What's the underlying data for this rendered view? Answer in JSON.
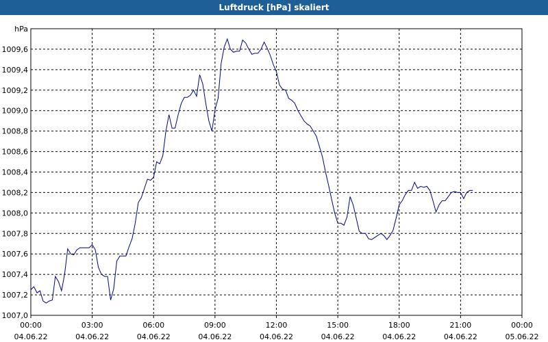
{
  "window": {
    "title": "Luftdruck [hPa] skaliert"
  },
  "chart_data": {
    "type": "line",
    "title": "Luftdruck [hPa] skaliert",
    "ylabel": "hPa",
    "xlabel": "",
    "ylim": [
      1007.0,
      1009.8
    ],
    "xlim": [
      0,
      24
    ],
    "grid": true,
    "y_ticks": [
      "1007,0",
      "1007,2",
      "1007,4",
      "1007,6",
      "1007,8",
      "1008,0",
      "1008,2",
      "1008,4",
      "1008,6",
      "1008,8",
      "1009,0",
      "1009,2",
      "1009,4",
      "1009,6"
    ],
    "x_ticks": [
      {
        "time": "00:00",
        "date": "04.06.22"
      },
      {
        "time": "03:00",
        "date": "04.06.22"
      },
      {
        "time": "06:00",
        "date": "04.06.22"
      },
      {
        "time": "09:00",
        "date": "04.06.22"
      },
      {
        "time": "12:00",
        "date": "04.06.22"
      },
      {
        "time": "15:00",
        "date": "04.06.22"
      },
      {
        "time": "18:00",
        "date": "04.06.22"
      },
      {
        "time": "21:00",
        "date": "04.06.22"
      },
      {
        "time": "00:00",
        "date": "05.06.22"
      }
    ],
    "series": [
      {
        "color": "#00008b",
        "points": [
          [
            0.0,
            1007.25
          ],
          [
            0.15,
            1007.28
          ],
          [
            0.3,
            1007.22
          ],
          [
            0.45,
            1007.24
          ],
          [
            0.6,
            1007.14
          ],
          [
            0.75,
            1007.12
          ],
          [
            0.9,
            1007.14
          ],
          [
            1.05,
            1007.15
          ],
          [
            1.2,
            1007.38
          ],
          [
            1.35,
            1007.33
          ],
          [
            1.5,
            1007.24
          ],
          [
            1.65,
            1007.4
          ],
          [
            1.8,
            1007.65
          ],
          [
            1.95,
            1007.6
          ],
          [
            2.1,
            1007.59
          ],
          [
            2.25,
            1007.64
          ],
          [
            2.4,
            1007.66
          ],
          [
            2.55,
            1007.66
          ],
          [
            2.7,
            1007.66
          ],
          [
            2.85,
            1007.66
          ],
          [
            3.0,
            1007.69
          ],
          [
            3.15,
            1007.64
          ],
          [
            3.3,
            1007.47
          ],
          [
            3.45,
            1007.4
          ],
          [
            3.6,
            1007.38
          ],
          [
            3.75,
            1007.38
          ],
          [
            3.9,
            1007.15
          ],
          [
            4.05,
            1007.26
          ],
          [
            4.2,
            1007.53
          ],
          [
            4.35,
            1007.58
          ],
          [
            4.5,
            1007.58
          ],
          [
            4.65,
            1007.58
          ],
          [
            4.8,
            1007.67
          ],
          [
            4.95,
            1007.75
          ],
          [
            5.1,
            1007.9
          ],
          [
            5.25,
            1008.1
          ],
          [
            5.4,
            1008.15
          ],
          [
            5.55,
            1008.24
          ],
          [
            5.7,
            1008.33
          ],
          [
            5.85,
            1008.32
          ],
          [
            6.0,
            1008.35
          ],
          [
            6.15,
            1008.5
          ],
          [
            6.3,
            1008.48
          ],
          [
            6.45,
            1008.56
          ],
          [
            6.6,
            1008.8
          ],
          [
            6.75,
            1008.96
          ],
          [
            6.9,
            1008.83
          ],
          [
            7.05,
            1008.83
          ],
          [
            7.2,
            1008.96
          ],
          [
            7.35,
            1009.07
          ],
          [
            7.5,
            1009.13
          ],
          [
            7.65,
            1009.13
          ],
          [
            7.8,
            1009.15
          ],
          [
            7.95,
            1009.2
          ],
          [
            8.1,
            1009.14
          ],
          [
            8.25,
            1009.35
          ],
          [
            8.4,
            1009.26
          ],
          [
            8.55,
            1009.07
          ],
          [
            8.7,
            1008.9
          ],
          [
            8.85,
            1008.8
          ],
          [
            9.0,
            1009.01
          ],
          [
            9.15,
            1009.12
          ],
          [
            9.3,
            1009.46
          ],
          [
            9.45,
            1009.62
          ],
          [
            9.6,
            1009.7
          ],
          [
            9.75,
            1009.6
          ],
          [
            9.9,
            1009.57
          ],
          [
            10.05,
            1009.58
          ],
          [
            10.2,
            1009.58
          ],
          [
            10.35,
            1009.69
          ],
          [
            10.5,
            1009.66
          ],
          [
            10.65,
            1009.6
          ],
          [
            10.8,
            1009.55
          ],
          [
            10.95,
            1009.56
          ],
          [
            11.1,
            1009.56
          ],
          [
            11.25,
            1009.6
          ],
          [
            11.4,
            1009.67
          ],
          [
            11.55,
            1009.61
          ],
          [
            11.7,
            1009.54
          ],
          [
            11.85,
            1009.45
          ],
          [
            12.0,
            1009.38
          ],
          [
            12.15,
            1009.25
          ],
          [
            12.3,
            1009.21
          ],
          [
            12.45,
            1009.2
          ],
          [
            12.6,
            1009.12
          ],
          [
            12.75,
            1009.1
          ],
          [
            12.9,
            1009.07
          ],
          [
            13.05,
            1009.0
          ],
          [
            13.2,
            1008.95
          ],
          [
            13.35,
            1008.9
          ],
          [
            13.5,
            1008.87
          ],
          [
            13.65,
            1008.85
          ],
          [
            13.8,
            1008.8
          ],
          [
            13.95,
            1008.75
          ],
          [
            14.1,
            1008.65
          ],
          [
            14.25,
            1008.55
          ],
          [
            14.4,
            1008.4
          ],
          [
            14.55,
            1008.27
          ],
          [
            14.7,
            1008.13
          ],
          [
            14.85,
            1008.0
          ],
          [
            15.0,
            1007.9
          ],
          [
            15.15,
            1007.9
          ],
          [
            15.3,
            1007.88
          ],
          [
            15.45,
            1007.96
          ],
          [
            15.6,
            1008.16
          ],
          [
            15.75,
            1008.08
          ],
          [
            15.9,
            1007.95
          ],
          [
            16.05,
            1007.82
          ],
          [
            16.2,
            1007.8
          ],
          [
            16.35,
            1007.8
          ],
          [
            16.5,
            1007.75
          ],
          [
            16.65,
            1007.74
          ],
          [
            16.8,
            1007.76
          ],
          [
            16.95,
            1007.78
          ],
          [
            17.1,
            1007.8
          ],
          [
            17.25,
            1007.78
          ],
          [
            17.4,
            1007.74
          ],
          [
            17.55,
            1007.78
          ],
          [
            17.7,
            1007.83
          ],
          [
            17.85,
            1007.95
          ],
          [
            18.0,
            1008.08
          ],
          [
            18.15,
            1008.12
          ],
          [
            18.3,
            1008.18
          ],
          [
            18.45,
            1008.22
          ],
          [
            18.6,
            1008.22
          ],
          [
            18.75,
            1008.3
          ],
          [
            18.9,
            1008.24
          ],
          [
            19.05,
            1008.26
          ],
          [
            19.2,
            1008.25
          ],
          [
            19.35,
            1008.26
          ],
          [
            19.5,
            1008.22
          ],
          [
            19.65,
            1008.12
          ],
          [
            19.8,
            1008.01
          ],
          [
            19.95,
            1008.08
          ],
          [
            20.1,
            1008.12
          ],
          [
            20.25,
            1008.12
          ],
          [
            20.4,
            1008.16
          ],
          [
            20.55,
            1008.2
          ],
          [
            20.7,
            1008.21
          ],
          [
            20.85,
            1008.2
          ],
          [
            21.0,
            1008.2
          ],
          [
            21.15,
            1008.14
          ],
          [
            21.3,
            1008.2
          ],
          [
            21.45,
            1008.22
          ],
          [
            21.6,
            1008.22
          ]
        ]
      }
    ]
  }
}
